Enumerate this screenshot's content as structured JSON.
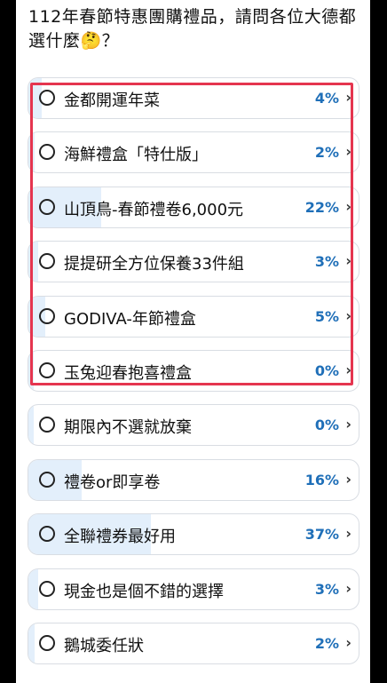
{
  "question": "112年春節特惠團購禮品，請問各位大德都選什麼🤔？",
  "colors": {
    "accent": "#1f6fb8",
    "fill": "#e3effb",
    "highlight": "#e5354f"
  },
  "options": [
    {
      "label": "金都開運年菜",
      "percent": "4%",
      "value": 4
    },
    {
      "label": "海鮮禮盒「特仕版」",
      "percent": "2%",
      "value": 2
    },
    {
      "label": "山頂鳥-春節禮卷6,000元",
      "percent": "22%",
      "value": 22
    },
    {
      "label": "提提研全方位保養33件組",
      "percent": "3%",
      "value": 3
    },
    {
      "label": "GODIVA-年節禮盒",
      "percent": "5%",
      "value": 5
    },
    {
      "label": "玉兔迎春抱喜禮盒",
      "percent": "0%",
      "value": 0
    },
    {
      "label": "期限內不選就放棄",
      "percent": "0%",
      "value": 0
    },
    {
      "label": "禮卷or即享卷",
      "percent": "16%",
      "value": 16
    },
    {
      "label": "全聯禮券最好用",
      "percent": "37%",
      "value": 37
    },
    {
      "label": "現金也是個不錯的選擇",
      "percent": "3%",
      "value": 3
    },
    {
      "label": "鵝城委任狀",
      "percent": "2%",
      "value": 2
    }
  ],
  "chevron": "›"
}
